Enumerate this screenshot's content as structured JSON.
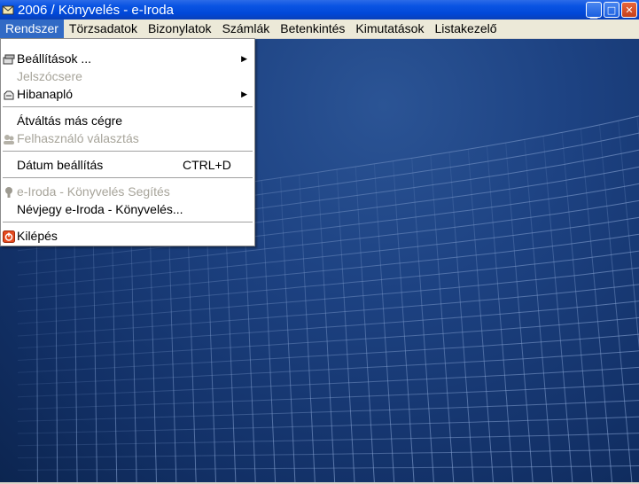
{
  "window": {
    "title": "2006 / Könyvelés - e-Iroda",
    "controls": {
      "minimize": "_",
      "maximize": "□",
      "close": "✕"
    }
  },
  "menubar": {
    "items": [
      {
        "label": "Rendszer",
        "active": true
      },
      {
        "label": "Törzsadatok"
      },
      {
        "label": "Bizonylatok"
      },
      {
        "label": "Számlák"
      },
      {
        "label": "Betenkintés"
      },
      {
        "label": "Kimutatások"
      },
      {
        "label": "Listakezelő"
      }
    ]
  },
  "dropdown": {
    "items": [
      {
        "label": "Beállítások ...",
        "icon": "settings-icon",
        "submenu": true,
        "enabled": true
      },
      {
        "label": "Jelszócsere",
        "enabled": false
      },
      {
        "label": "Hibanapló",
        "icon": "log-icon",
        "submenu": true,
        "enabled": true
      },
      {
        "label": "Átváltás más cégre",
        "enabled": true
      },
      {
        "label": "Felhasználó választás",
        "icon": "users-icon",
        "enabled": false
      },
      {
        "label": "Dátum beállítás",
        "shortcut": "CTRL+D",
        "enabled": true
      },
      {
        "label": "e-Iroda - Könyvelés Segítés",
        "icon": "help-icon",
        "enabled": false
      },
      {
        "label": "Névjegy e-Iroda - Könyvelés...",
        "enabled": true
      },
      {
        "label": "Kilépés",
        "icon": "exit-icon",
        "enabled": true
      }
    ]
  },
  "colors": {
    "menu_highlight": "#316ac5",
    "titlebar": "#0a54e3",
    "desktop": "#1d4282"
  }
}
